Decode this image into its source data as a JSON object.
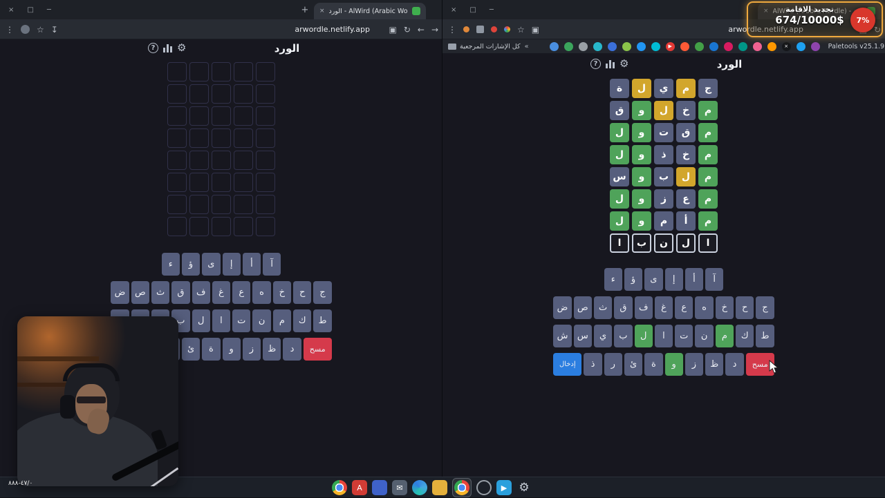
{
  "chrome": {
    "window_controls": [
      "×",
      "□",
      "─"
    ],
    "left_window": {
      "tab_title": "الورد - AlWird (Arabic Wordle)",
      "new_tab_label": "+",
      "tab_close": "×",
      "url": "arwordle.netlify.app"
    },
    "right_window": {
      "tab_title": "AlWird (Arabic Wordle) - الورد",
      "tab_close": "×",
      "url": "arwordle.netlify.app"
    },
    "bookmarks_bar": {
      "all_bookmarks_label": "كل الإشارات المرجعية",
      "chevron": "«",
      "paletools_label": "Paletools v25.1.9",
      "favicons": [
        {
          "c": "#4a8fe0"
        },
        {
          "c": "#3ba55c"
        },
        {
          "c": "#9aa0a6"
        },
        {
          "c": "#28b8cc"
        },
        {
          "c": "#3b6fd9"
        },
        {
          "c": "#8bc34a"
        },
        {
          "c": "#2196f3"
        },
        {
          "c": "#00bcd4"
        },
        {
          "c": "#e53935",
          "t": "▶"
        },
        {
          "c": "#ff5a36"
        },
        {
          "c": "#43a047"
        },
        {
          "c": "#1976d2"
        },
        {
          "c": "#d81b60"
        },
        {
          "c": "#009688"
        },
        {
          "c": "#f06292"
        },
        {
          "c": "#ff9800"
        },
        {
          "c": "#15171a",
          "t": "×"
        },
        {
          "c": "#1da1f2"
        },
        {
          "c": "#8e44ad"
        }
      ]
    }
  },
  "game": {
    "title": "الورد",
    "header_icons": {
      "help": "?"
    },
    "left_grid": {
      "rows": 8,
      "cols": 5
    },
    "right_grid_rows": [
      [
        {
          "ch": "ة",
          "st": "absent"
        },
        {
          "ch": "ل",
          "st": "present"
        },
        {
          "ch": "ي",
          "st": "absent"
        },
        {
          "ch": "م",
          "st": "present"
        },
        {
          "ch": "ج",
          "st": "absent"
        }
      ],
      [
        {
          "ch": "ق",
          "st": "absent"
        },
        {
          "ch": "و",
          "st": "correct"
        },
        {
          "ch": "ل",
          "st": "present"
        },
        {
          "ch": "خ",
          "st": "absent"
        },
        {
          "ch": "م",
          "st": "correct"
        }
      ],
      [
        {
          "ch": "ل",
          "st": "correct"
        },
        {
          "ch": "و",
          "st": "correct"
        },
        {
          "ch": "ت",
          "st": "absent"
        },
        {
          "ch": "ق",
          "st": "absent"
        },
        {
          "ch": "م",
          "st": "correct"
        }
      ],
      [
        {
          "ch": "ل",
          "st": "correct"
        },
        {
          "ch": "و",
          "st": "correct"
        },
        {
          "ch": "ذ",
          "st": "absent"
        },
        {
          "ch": "خ",
          "st": "absent"
        },
        {
          "ch": "م",
          "st": "correct"
        }
      ],
      [
        {
          "ch": "س",
          "st": "absent"
        },
        {
          "ch": "و",
          "st": "correct"
        },
        {
          "ch": "ب",
          "st": "absent"
        },
        {
          "ch": "ل",
          "st": "present"
        },
        {
          "ch": "م",
          "st": "correct"
        }
      ],
      [
        {
          "ch": "ل",
          "st": "correct"
        },
        {
          "ch": "و",
          "st": "correct"
        },
        {
          "ch": "ز",
          "st": "absent"
        },
        {
          "ch": "ع",
          "st": "absent"
        },
        {
          "ch": "م",
          "st": "correct"
        }
      ],
      [
        {
          "ch": "ل",
          "st": "correct"
        },
        {
          "ch": "و",
          "st": "correct"
        },
        {
          "ch": "م",
          "st": "absent"
        },
        {
          "ch": "أ",
          "st": "absent"
        },
        {
          "ch": "م",
          "st": "correct"
        }
      ],
      [
        {
          "ch": "ا",
          "st": "current"
        },
        {
          "ch": "ب",
          "st": "current"
        },
        {
          "ch": "ن",
          "st": "current"
        },
        {
          "ch": "ل",
          "st": "current"
        },
        {
          "ch": "ا",
          "st": "current"
        }
      ]
    ],
    "keyboard": {
      "rows": [
        [
          "ء",
          "ؤ",
          "ى",
          "إ",
          "أ",
          "آ"
        ],
        [
          "ض",
          "ص",
          "ث",
          "ق",
          "ف",
          "غ",
          "ع",
          "ه",
          "خ",
          "ح",
          "ج"
        ],
        [
          "ش",
          "س",
          "ي",
          "ب",
          "ل",
          "ا",
          "ت",
          "ن",
          "م",
          "ك",
          "ط"
        ],
        [
          {
            "label": "إدخال",
            "action": "enter"
          },
          "ذ",
          "ر",
          "ئ",
          "ة",
          "و",
          "ز",
          "ظ",
          "د",
          {
            "label": "مسح",
            "action": "delete"
          }
        ]
      ],
      "right_correct_keys": [
        "ل",
        "م",
        "و"
      ]
    }
  },
  "stream_overlay": {
    "title": "تجديد الاقامة",
    "amount": "674/10000$",
    "badge": "7%"
  },
  "taskbar": {
    "corner_text": "٤٧/٠-٨٨٨",
    "icons": [
      {
        "name": "chrome",
        "style": "chrome"
      },
      {
        "name": "red-a-app",
        "style": "solid",
        "color": "#d13c35",
        "glyph": "A"
      },
      {
        "name": "blue-app",
        "style": "solid",
        "color": "#3f62c9"
      },
      {
        "name": "mail-app",
        "style": "solid",
        "color": "#556070",
        "glyph": "✉"
      },
      {
        "name": "edge",
        "style": "edge"
      },
      {
        "name": "folder",
        "style": "solid",
        "color": "#e4b03c"
      },
      {
        "name": "chrome-active",
        "style": "chrome",
        "active": true
      },
      {
        "name": "ring-app",
        "style": "ring",
        "color": "#99a0a8"
      },
      {
        "name": "telegram",
        "style": "solid",
        "color": "#2ba0dd",
        "glyph": "▶"
      },
      {
        "name": "settings",
        "style": "glyph",
        "glyph": "⚙"
      },
      {
        "name": "windows-start",
        "style": "windows"
      }
    ]
  },
  "colors": {
    "correct": "#4fa35a",
    "present": "#d2a62c",
    "absent": "#565e7d",
    "enter": "#2b7ee0",
    "delete": "#d53a4b",
    "bg": "#17171f"
  }
}
